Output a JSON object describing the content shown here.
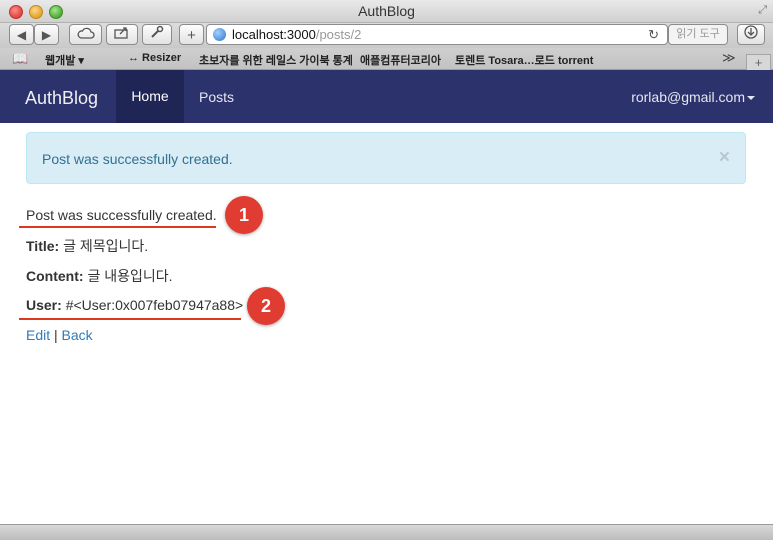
{
  "window": {
    "title": "AuthBlog"
  },
  "toolbar": {
    "url_host": "localhost:3000",
    "url_path": "/posts/2",
    "reader_label": "읽기 도구"
  },
  "bookmarks": {
    "items": [
      "웹개발 ▾",
      "↔ Resizer",
      "초보자를 위한 레일스 가이북 통계",
      "애플컴퓨터코리아",
      "토렌트 Tosara…로드 torrent"
    ],
    "more": "≫"
  },
  "navbar": {
    "brand": "AuthBlog",
    "home": "Home",
    "posts": "Posts",
    "user": "rorlab@gmail.com"
  },
  "alert": {
    "message": "Post was successfully created.",
    "close": "×"
  },
  "content": {
    "notice": "Post was successfully created.",
    "title_label": "Title:",
    "title_value": "글 제목입니다.",
    "content_label": "Content:",
    "content_value": "글 내용입니다.",
    "user_label": "User:",
    "user_value": "#<User:0x007feb07947a88>",
    "edit": "Edit",
    "separator": "|",
    "back": "Back"
  },
  "annotations": {
    "badge1": "1",
    "badge2": "2"
  },
  "colors": {
    "navbar": "#2b326c",
    "alert_bg": "#d9edf7",
    "alert_text": "#31708f",
    "annotation": "#e03c31",
    "link": "#337ab7"
  }
}
